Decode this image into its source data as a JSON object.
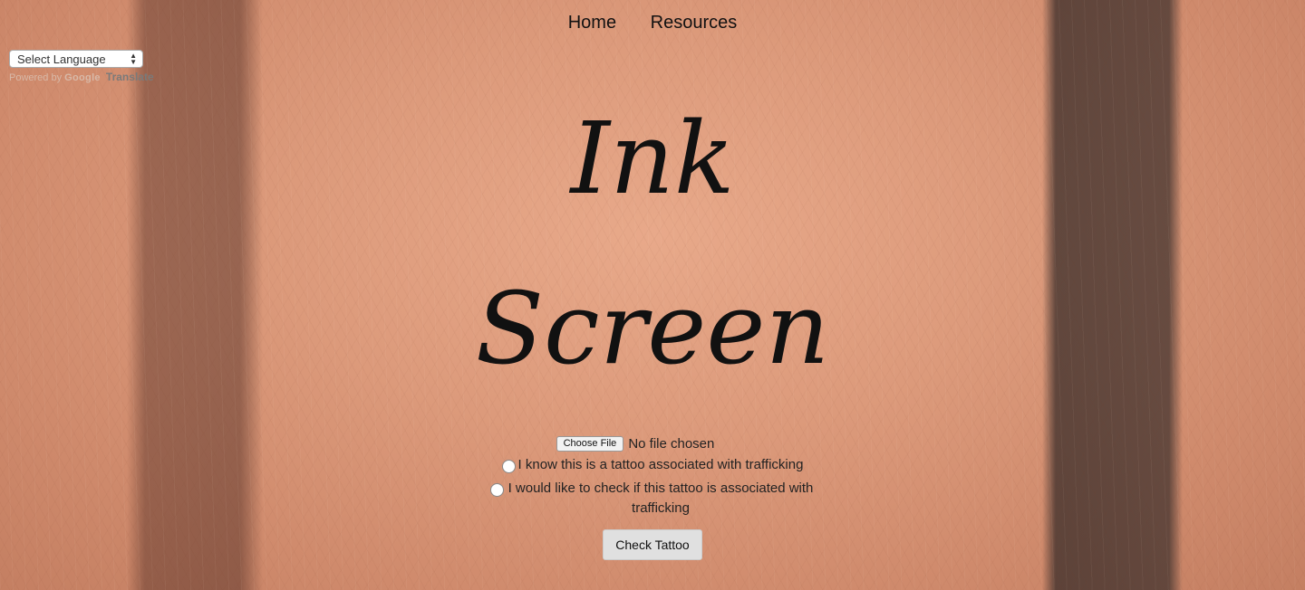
{
  "nav": {
    "items": [
      "Home",
      "Resources"
    ]
  },
  "translate": {
    "select_label": "Select Language",
    "powered_by": "Powered by",
    "google_logo": "Google",
    "translate_word": "Translate"
  },
  "hero": {
    "line1": "Ink",
    "line2": "Screen"
  },
  "upload": {
    "button_label": "Choose File",
    "status": "No file chosen"
  },
  "options": [
    {
      "label": "I know this is a tattoo associated with trafficking",
      "selected": false
    },
    {
      "label": "I would like to check if this tattoo is associated with trafficking",
      "selected": false
    }
  ],
  "submit": {
    "label": "Check Tattoo"
  }
}
